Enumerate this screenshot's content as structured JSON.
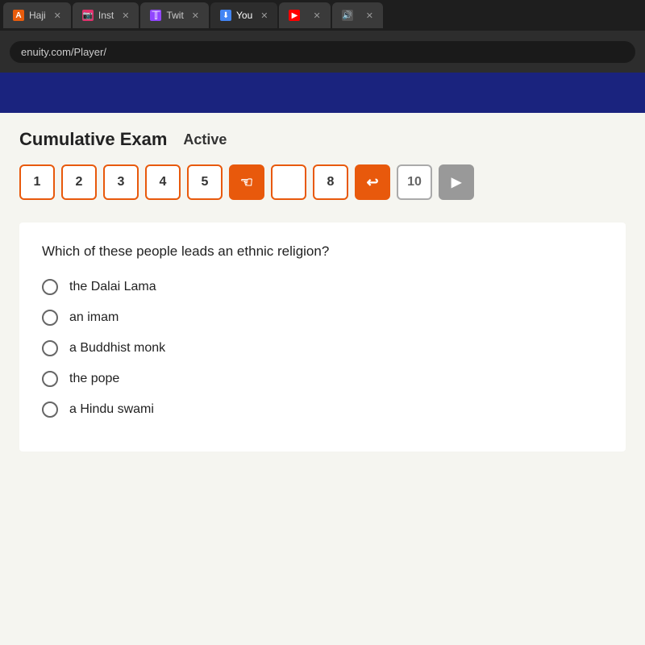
{
  "browser": {
    "tabs": [
      {
        "id": "haji",
        "icon_type": "orange",
        "icon_label": "A",
        "label": "Haji",
        "active": false
      },
      {
        "id": "inst",
        "icon_type": "pink",
        "icon_label": "📷",
        "label": "Inst",
        "active": false
      },
      {
        "id": "twit",
        "icon_type": "purple",
        "icon_label": "▪",
        "label": "Twit",
        "active": false
      },
      {
        "id": "you",
        "icon_type": "blue",
        "icon_label": "⬇",
        "label": "You",
        "active": true
      },
      {
        "id": "yt",
        "icon_type": "red",
        "icon_label": "▶",
        "label": "",
        "active": false
      },
      {
        "id": "snd",
        "icon_type": "gray",
        "icon_label": "🔊",
        "label": "",
        "active": false
      }
    ],
    "url": "enuity.com/Player/"
  },
  "exam": {
    "title": "Cumulative Exam",
    "status": "Active"
  },
  "nav_buttons": [
    {
      "label": "1",
      "type": "normal"
    },
    {
      "label": "2",
      "type": "normal"
    },
    {
      "label": "3",
      "type": "normal"
    },
    {
      "label": "4",
      "type": "normal"
    },
    {
      "label": "5",
      "type": "normal"
    },
    {
      "label": "←",
      "type": "arrow"
    },
    {
      "label": "",
      "type": "normal"
    },
    {
      "label": "8",
      "type": "normal"
    },
    {
      "label": "↩",
      "type": "arrow"
    },
    {
      "label": "10",
      "type": "gray"
    },
    {
      "label": "▶",
      "type": "gray-arrow"
    }
  ],
  "question": {
    "text": "Which of these people leads an ethnic religion?",
    "options": [
      {
        "id": "a",
        "text": "the Dalai Lama"
      },
      {
        "id": "b",
        "text": "an imam"
      },
      {
        "id": "c",
        "text": "a Buddhist monk"
      },
      {
        "id": "d",
        "text": "the pope"
      },
      {
        "id": "e",
        "text": "a Hindu swami"
      }
    ]
  }
}
